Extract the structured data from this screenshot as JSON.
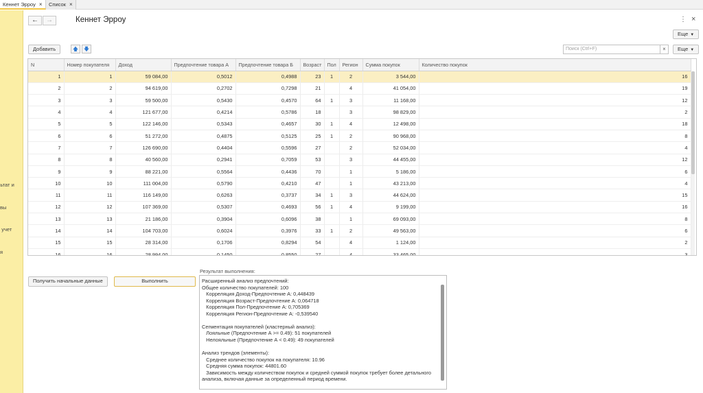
{
  "tabs": [
    {
      "label": "Кеннет Эрроу",
      "close": "×"
    },
    {
      "label": "Список",
      "close": "×"
    }
  ],
  "sidebar": {
    "items": [
      "льтат и",
      "вы",
      "й учет",
      "я"
    ]
  },
  "header": {
    "back": "←",
    "forward": "→",
    "title": "Кеннет Эрроу",
    "more_dots": "⋮",
    "close": "×"
  },
  "toolbar": {
    "more_top": "Еще",
    "add_label": "Добавить",
    "up_arrow": "🡅",
    "down_arrow": "🡇",
    "search_placeholder": "Поиск (Ctrl+F)",
    "search_clear": "×",
    "more_label": "Еще"
  },
  "table": {
    "columns": [
      "N",
      "Номер покупателя",
      "Доход",
      "Предпочтение товара А",
      "Предпочтение товара Б",
      "Возраст",
      "Пол",
      "Регион",
      "Сумма покупок",
      "Количество покупок"
    ],
    "rows": [
      [
        "1",
        "1",
        "59 084,00",
        "0,5012",
        "0,4988",
        "23",
        "1",
        "2",
        "3 544,00",
        "16"
      ],
      [
        "2",
        "2",
        "94 619,00",
        "0,2702",
        "0,7298",
        "21",
        "",
        "4",
        "41 054,00",
        "19"
      ],
      [
        "3",
        "3",
        "59 500,00",
        "0,5430",
        "0,4570",
        "64",
        "1",
        "3",
        "11 168,00",
        "12"
      ],
      [
        "4",
        "4",
        "121 677,00",
        "0,4214",
        "0,5786",
        "18",
        "",
        "3",
        "98 829,00",
        "2"
      ],
      [
        "5",
        "5",
        "122 146,00",
        "0,5343",
        "0,4657",
        "30",
        "1",
        "4",
        "12 498,00",
        "18"
      ],
      [
        "6",
        "6",
        "51 272,00",
        "0,4875",
        "0,5125",
        "25",
        "1",
        "2",
        "90 968,00",
        "8"
      ],
      [
        "7",
        "7",
        "126 690,00",
        "0,4404",
        "0,5596",
        "27",
        "",
        "2",
        "52 034,00",
        "4"
      ],
      [
        "8",
        "8",
        "40 560,00",
        "0,2941",
        "0,7059",
        "53",
        "",
        "3",
        "44 455,00",
        "12"
      ],
      [
        "9",
        "9",
        "88 221,00",
        "0,5564",
        "0,4436",
        "70",
        "",
        "1",
        "5 186,00",
        "6"
      ],
      [
        "10",
        "10",
        "111 004,00",
        "0,5790",
        "0,4210",
        "47",
        "",
        "1",
        "43 213,00",
        "4"
      ],
      [
        "11",
        "11",
        "116 149,00",
        "0,6263",
        "0,3737",
        "34",
        "1",
        "3",
        "44 624,00",
        "15"
      ],
      [
        "12",
        "12",
        "107 369,00",
        "0,5307",
        "0,4693",
        "56",
        "1",
        "4",
        "9 199,00",
        "16"
      ],
      [
        "13",
        "13",
        "21 186,00",
        "0,3904",
        "0,6096",
        "38",
        "",
        "1",
        "69 093,00",
        "8"
      ],
      [
        "14",
        "14",
        "104 703,00",
        "0,6024",
        "0,3976",
        "33",
        "1",
        "2",
        "49 563,00",
        "6"
      ],
      [
        "15",
        "15",
        "28 314,00",
        "0,1706",
        "0,8294",
        "54",
        "",
        "4",
        "1 124,00",
        "2"
      ],
      [
        "16",
        "16",
        "28 994,00",
        "0,1450",
        "0,8550",
        "27",
        "",
        "4",
        "33 465,00",
        "3"
      ]
    ]
  },
  "actions": {
    "get_data_label": "Получить начальные данные",
    "run_label": "Выполнить"
  },
  "result": {
    "label": "Результат выполнения:",
    "lines": [
      "Расширенный анализ предпочтений:",
      "Общее количество покупателей: 100",
      "   Корреляция Доход-Предпочтение А: 0,448439",
      "   Корреляция Возраст-Предпочтение А: 0,064718",
      "   Корреляция Пол-Предпочтение А: 0,705369",
      "   Корреляция Регион-Предпочтение А: -0,539540",
      "",
      "Сегментация покупателей (кластерный анализ):",
      "   Лояльные (Предпочтение А >= 0.49): 51 покупателей",
      "   Нелояльные (Предпочтение А < 0.49): 49 покупателей",
      "",
      "Анализ трендов (элементы):",
      "   Среднее количество покупок на покупателя: 10.96",
      "   Средняя сумма покупок: 44801.60",
      "   Зависимость между количеством покупок и средней суммой покупок требует более детального анализа, включая данные за определенный период времени."
    ]
  }
}
